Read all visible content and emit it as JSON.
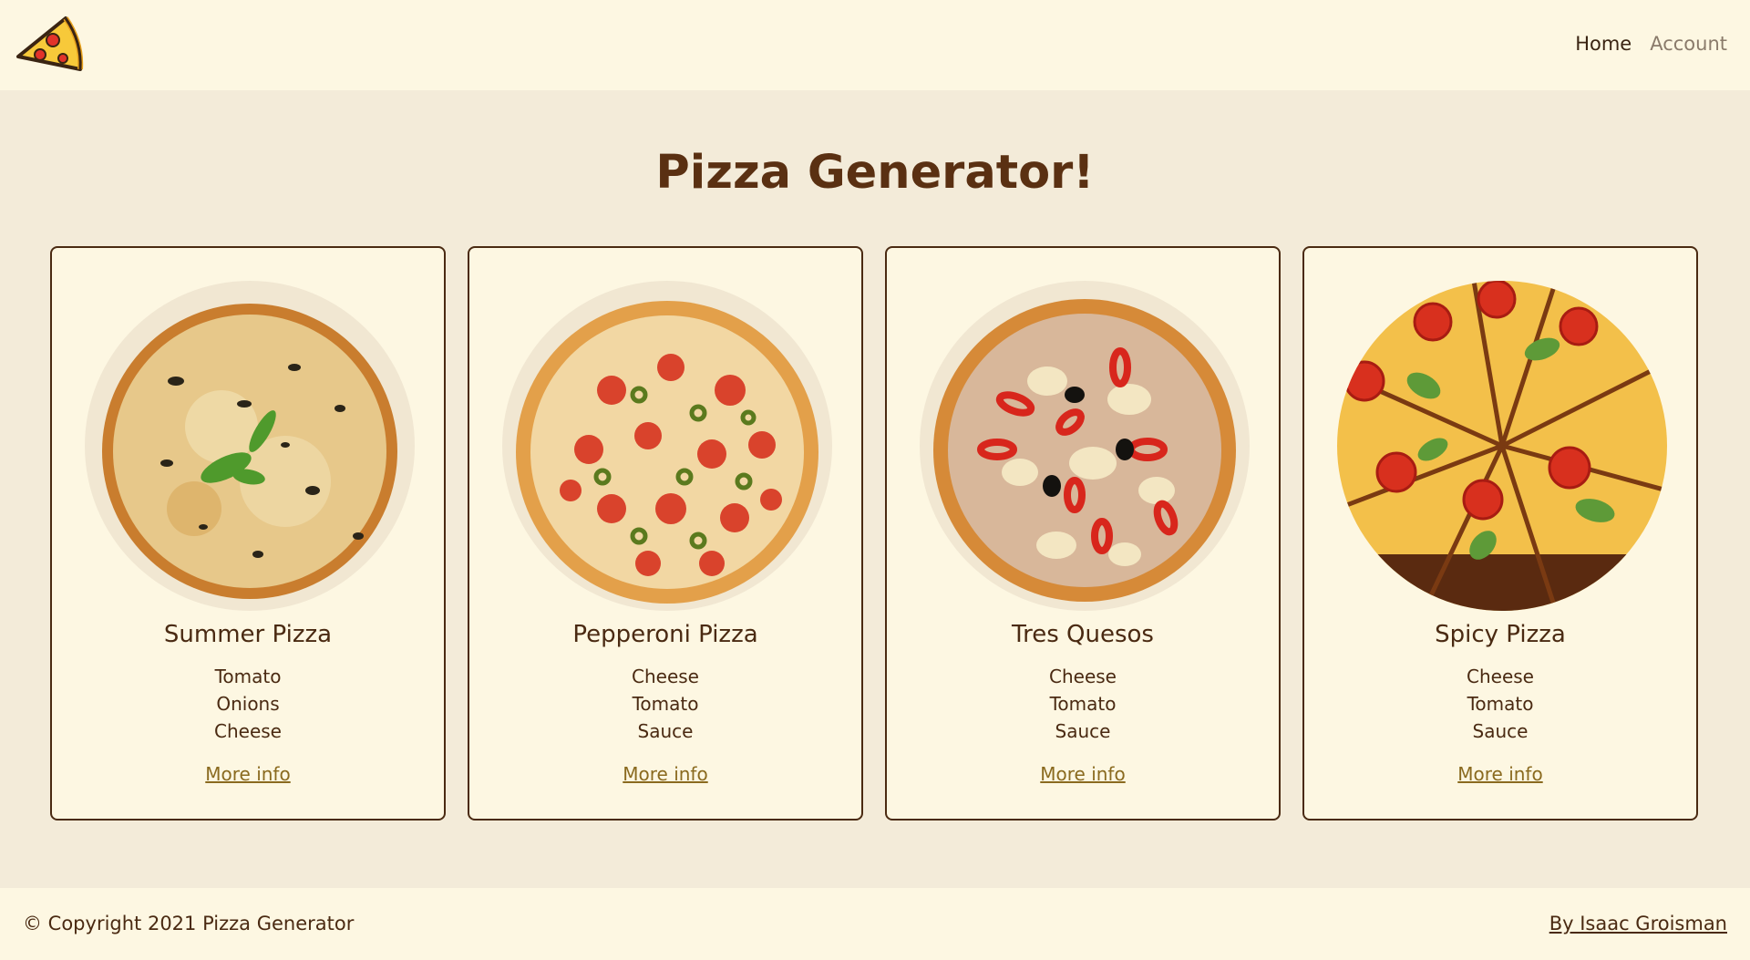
{
  "header": {
    "logo_icon": "pizza-slice-icon",
    "nav": {
      "home": "Home",
      "account": "Account"
    }
  },
  "main": {
    "title": "Pizza Generator!",
    "cards": [
      {
        "name": "Summer Pizza",
        "ingredients": [
          "Tomato",
          "Onions",
          "Cheese"
        ],
        "link": "More info",
        "image_icon": "summer-pizza-image"
      },
      {
        "name": "Pepperoni Pizza",
        "ingredients": [
          "Cheese",
          "Tomato",
          "Sauce"
        ],
        "link": "More info",
        "image_icon": "pepperoni-pizza-image"
      },
      {
        "name": "Tres Quesos",
        "ingredients": [
          "Cheese",
          "Tomato",
          "Sauce"
        ],
        "link": "More info",
        "image_icon": "tres-quesos-pizza-image"
      },
      {
        "name": "Spicy Pizza",
        "ingredients": [
          "Cheese",
          "Tomato",
          "Sauce"
        ],
        "link": "More info",
        "image_icon": "spicy-pizza-image"
      }
    ]
  },
  "footer": {
    "copyright": "© Copyright 2021 Pizza Generator",
    "author": "By Isaac Groisman"
  },
  "colors": {
    "background": "#f3ebd9",
    "surface": "#fdf7e2",
    "text": "#4a2a12",
    "title": "#5a3012",
    "link": "#8a6a1f"
  }
}
